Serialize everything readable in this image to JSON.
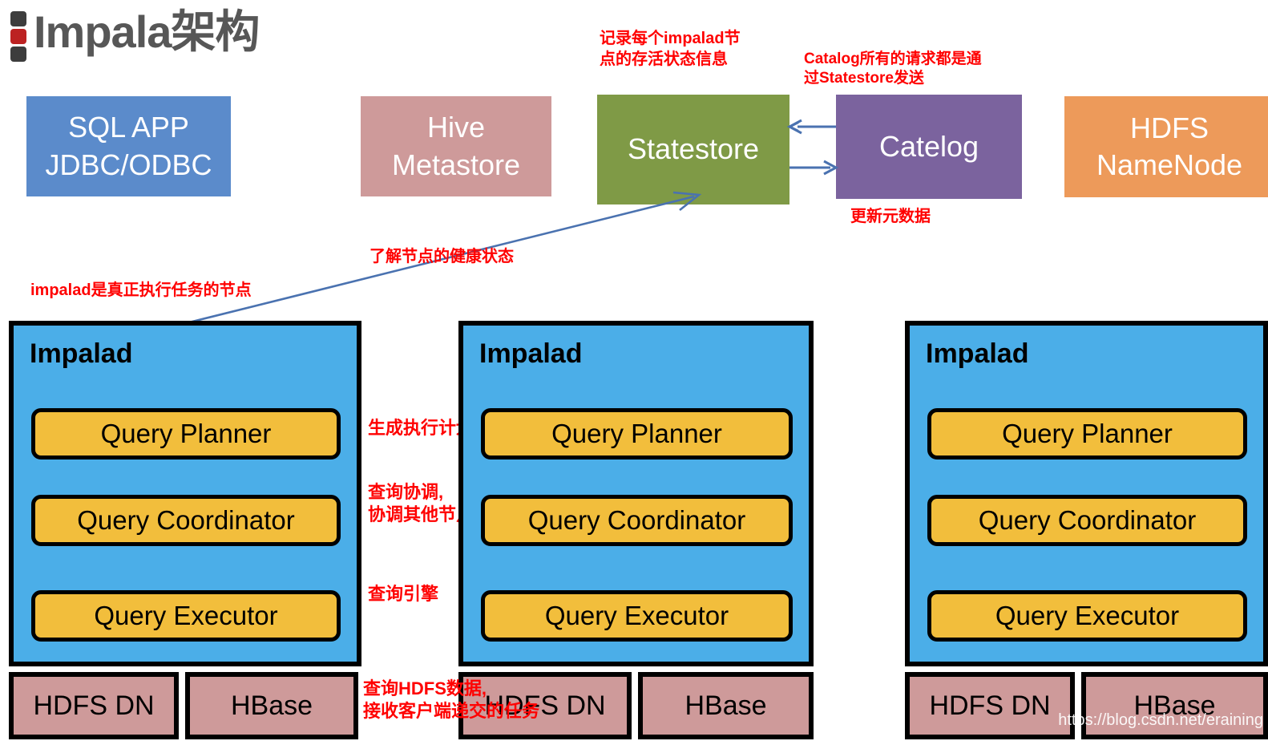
{
  "header": {
    "title": "Impala架构",
    "logo_icon": "three-square-bullet-icon"
  },
  "top_row": [
    {
      "id": "sql-app",
      "label": "SQL APP\nJDBC/ODBC",
      "color": "#5b8bcb"
    },
    {
      "id": "hive",
      "label": "Hive\nMetastore",
      "color": "#ce9a9a"
    },
    {
      "id": "statestore",
      "label": "Statestore",
      "color": "#7f9a46"
    },
    {
      "id": "catelog",
      "label": "Catelog",
      "color": "#7b639e"
    },
    {
      "id": "namenode",
      "label": "HDFS\nNameNode",
      "color": "#ed9a5a"
    }
  ],
  "annotations": {
    "statestore_note": "记录每个impalad节\n点的存活状态信息",
    "catalog_note": "Catalog所有的请求都是通\n过Statestore发送",
    "update_metadata": "更新元数据",
    "node_health": "了解节点的健康状态",
    "impalad_note": "impalad是真正执行任务的节点",
    "query_plan": "生成执行计划",
    "query_coordinate": "查询协调,\n协调其他节点",
    "query_engine": "查询引擎",
    "query_hdfs": "查询HDFS数据,\n接收客户端递交的任务",
    "color": "#ff0000"
  },
  "impalad_nodes": [
    {
      "title": "Impalad",
      "components": [
        "Query Planner",
        "Query Coordinator",
        "Query Executor"
      ],
      "storage": [
        "HDFS DN",
        "HBase"
      ]
    },
    {
      "title": "Impalad",
      "components": [
        "Query Planner",
        "Query Coordinator",
        "Query Executor"
      ],
      "storage": [
        "HDFS DN",
        "HBase"
      ]
    },
    {
      "title": "Impalad",
      "components": [
        "Query Planner",
        "Query Coordinator",
        "Query Executor"
      ],
      "storage": [
        "HDFS DN",
        "HBase"
      ]
    }
  ],
  "colors": {
    "impalad_fill": "#4baee8",
    "component_fill": "#f2be3c",
    "storage_fill": "#ce9a9a",
    "arrow": "#4a72b0",
    "annotation": "#ff0000",
    "title": "#575757"
  },
  "arrows": [
    {
      "name": "catelog-to-statestore",
      "direction": "left"
    },
    {
      "name": "statestore-to-catelog",
      "direction": "right"
    },
    {
      "name": "impalad-to-statestore",
      "direction": "up-right"
    }
  ],
  "watermark": "https://blog.csdn.net/eraining"
}
